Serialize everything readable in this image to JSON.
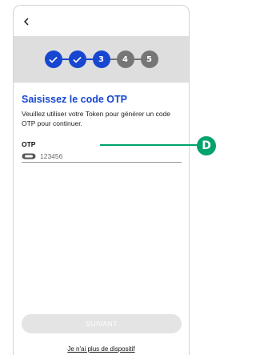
{
  "header": {
    "back_icon": "chevron-left-icon"
  },
  "stepper": {
    "steps": [
      {
        "status": "done",
        "icon": "checkmark-icon"
      },
      {
        "status": "done",
        "icon": "checkmark-icon"
      },
      {
        "status": "current",
        "label": "3"
      },
      {
        "status": "todo",
        "label": "4"
      },
      {
        "status": "todo",
        "label": "5"
      }
    ],
    "active_color": "#1746d0",
    "inactive_color": "#767676"
  },
  "content": {
    "title": "Saisissez le code OTP",
    "description": "Veuillez utiliser votre Token pour générer un code OTP pour continuer.",
    "otp_label": "OTP",
    "otp_placeholder": "123456",
    "otp_icon": "token-icon"
  },
  "footer": {
    "submit_label": "SUIVANT",
    "no_device_link": "Je n'ai plus de dispositif"
  },
  "annotation": {
    "badge_label": "D",
    "color": "#00a36c"
  }
}
